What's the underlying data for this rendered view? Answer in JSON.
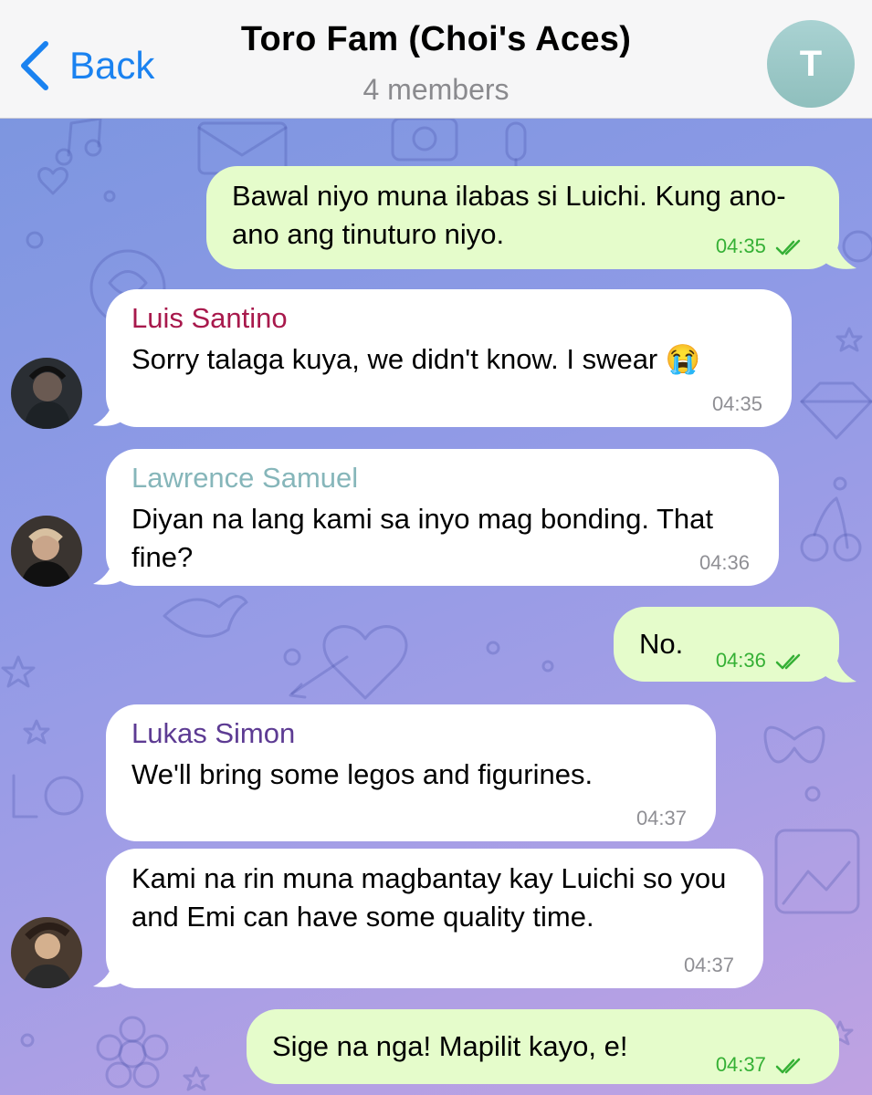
{
  "header": {
    "back_label": "Back",
    "title": "Toro Fam (Choi's Aces)",
    "subtitle": "4 members",
    "avatar_letter": "T"
  },
  "messages": [
    {
      "sender": "",
      "text": "Bawal niyo muna ilabas si Luichi. Kung ano-ano ang tinuturo niyo.",
      "time": "04:35",
      "outgoing": true,
      "read": true
    },
    {
      "sender": "Luis Santino",
      "text": "Sorry talaga kuya, we didn't know. I swear 😭",
      "time": "04:35",
      "outgoing": false,
      "sender_color": "#a8194c"
    },
    {
      "sender": "Lawrence Samuel",
      "text": "Diyan na lang kami sa inyo mag bonding. That fine?",
      "time": "04:36",
      "outgoing": false,
      "sender_color": "#86b6ba"
    },
    {
      "sender": "",
      "text": "No.",
      "time": "04:36",
      "outgoing": true,
      "read": true
    },
    {
      "sender": "Lukas Simon",
      "text": "We'll bring some legos and figurines.",
      "time": "04:37",
      "outgoing": false,
      "sender_color": "#5d3b93"
    },
    {
      "sender": "",
      "text": "Kami na rin muna magbantay kay Luichi so you and Emi can have some quality time.",
      "time": "04:37",
      "outgoing": false
    },
    {
      "sender": "",
      "text": "Sige na nga! Mapilit kayo, e!",
      "time": "04:37",
      "outgoing": true,
      "read": true
    }
  ],
  "colors": {
    "accent": "#1a82f0",
    "outgoing_bubble": "#e5fccb",
    "incoming_bubble": "#ffffff",
    "timestamp_outgoing": "#35b035"
  }
}
